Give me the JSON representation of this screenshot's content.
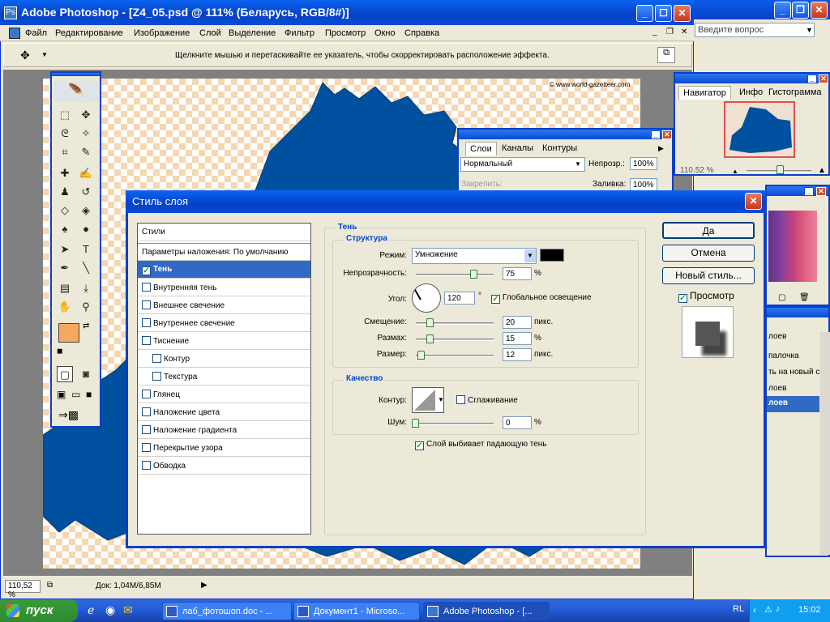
{
  "window": {
    "title": "Adobe Photoshop - [Z4_05.psd @ 111% (Беларусь, RGB/8#)]"
  },
  "menu": [
    "Файл",
    "Редактирование",
    "Изображение",
    "Слой",
    "Выделение",
    "Фильтр",
    "Просмотр",
    "Окно",
    "Справка"
  ],
  "help_placeholder": "Введите вопрос",
  "options_hint": "Щелкните мышью и перетаскивайте ее указатель, чтобы скорректировать расположение эффекта.",
  "watermark": "© www.world-gazetteer.com",
  "status": {
    "zoom": "110,52 %",
    "doc": "Док: 1,04M/6,85M"
  },
  "navigator": {
    "tabs": [
      "Навигатор",
      "Инфо",
      "Гистограмма"
    ],
    "zoom": "110.52 %"
  },
  "layers_panel": {
    "tabs": [
      "Слои",
      "Каналы",
      "Контуры"
    ],
    "blend_mode": "Нормальный",
    "opacity_label": "Непрозр.:",
    "opacity": "100%",
    "lock_label": "Закрепить:",
    "fill_label": "Заливка:",
    "fill": "100%"
  },
  "history_items": [
    "лоев",
    "палочка",
    "ть на новый с...",
    "лоев",
    "лоев"
  ],
  "dialog": {
    "title": "Стиль слоя",
    "styles_header": "Стили",
    "blend_defaults": "Параметры наложения: По умолчанию",
    "styles": [
      {
        "label": "Тень",
        "checked": true,
        "selected": true,
        "sub": false
      },
      {
        "label": "Внутренняя тень",
        "checked": false,
        "selected": false,
        "sub": false
      },
      {
        "label": "Внешнее свечение",
        "checked": false,
        "selected": false,
        "sub": false
      },
      {
        "label": "Внутреннее свечение",
        "checked": false,
        "selected": false,
        "sub": false
      },
      {
        "label": "Тиснение",
        "checked": false,
        "selected": false,
        "sub": false
      },
      {
        "label": "Контур",
        "checked": false,
        "selected": false,
        "sub": true
      },
      {
        "label": "Текстура",
        "checked": false,
        "selected": false,
        "sub": true
      },
      {
        "label": "Глянец",
        "checked": false,
        "selected": false,
        "sub": false
      },
      {
        "label": "Наложение цвета",
        "checked": false,
        "selected": false,
        "sub": false
      },
      {
        "label": "Наложение градиента",
        "checked": false,
        "selected": false,
        "sub": false
      },
      {
        "label": "Перекрытие узора",
        "checked": false,
        "selected": false,
        "sub": false
      },
      {
        "label": "Обводка",
        "checked": false,
        "selected": false,
        "sub": false
      }
    ],
    "section_title": "Тень",
    "structure": {
      "title": "Структура",
      "mode_label": "Режим:",
      "mode": "Умножение",
      "opacity_label": "Непрозрачность:",
      "opacity": "75",
      "opacity_unit": "%",
      "angle_label": "Угол:",
      "angle": "120",
      "angle_unit": "°",
      "global_light": "Глобальное освещение",
      "distance_label": "Смещение:",
      "distance": "20",
      "distance_unit": "пикс.",
      "spread_label": "Размах:",
      "spread": "15",
      "spread_unit": "%",
      "size_label": "Размер:",
      "size": "12",
      "size_unit": "пикс."
    },
    "quality": {
      "title": "Качество",
      "contour_label": "Контур:",
      "antialias": "Сглаживание",
      "noise_label": "Шум:",
      "noise": "0",
      "noise_unit": "%"
    },
    "knockout": "Слой выбивает падающую тень",
    "buttons": {
      "ok": "Да",
      "cancel": "Отмена",
      "new_style": "Новый стиль...",
      "preview": "Просмотр"
    }
  },
  "colors": {
    "map": "#0050a0",
    "foreground": "#f6a860",
    "background": "#c8a890"
  },
  "taskbar": {
    "start": "пуск",
    "tasks": [
      "лаб_фотошоп.doc - ...",
      "Документ1 - Microso...",
      "Adobe Photoshop - [..."
    ],
    "lang": "RL",
    "time": "15:02"
  }
}
